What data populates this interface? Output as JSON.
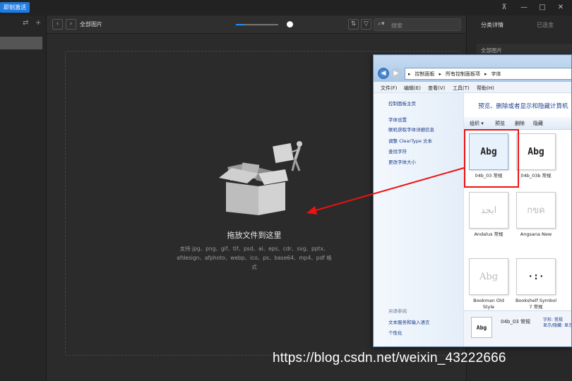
{
  "titlebar": {
    "activate_label": "即刻激活",
    "pin_icon": "pin-icon",
    "minimize": "—",
    "maximize": "□",
    "close": "✕"
  },
  "sidebar": {
    "sort_icon": "⇄",
    "add_icon": "+"
  },
  "toolbar": {
    "back": "‹",
    "forward": "›",
    "folder_title": "全部图片",
    "zoom_level": 0.18,
    "sort_icon": "⇅",
    "filter_icon": "▽",
    "search_icon": "⌕▾",
    "search_placeholder": "搜索"
  },
  "dropzone": {
    "title": "拖放文件到这里",
    "formats": "支持 jpg、png、gif、tif、psd、ai、eps、cdr、svg、pptx、afdesign、afphoto、webp、ico、ps、base64、mp4、pdf 格式"
  },
  "right_panel": {
    "tab_details": "分类详情",
    "tab_other": "已选金",
    "field": "全部图片"
  },
  "explorer": {
    "path": [
      "控制面板",
      "所有控制面板项",
      "字体"
    ],
    "menu": [
      "文件(F)",
      "编辑(E)",
      "查看(V)",
      "工具(T)",
      "帮助(H)"
    ],
    "left_links": [
      "控制面板主页",
      "字体设置",
      "联机获取字体详细信息",
      "调整 ClearType 文本",
      "查找字符",
      "更改字体大小"
    ],
    "see_also_title": "另请参阅",
    "see_also_links": [
      "文本服务和输入语言",
      "个性化"
    ],
    "heading": "预览、删除或者显示和隐藏计算机",
    "commands": [
      "组织 ▾",
      "预览",
      "删除",
      "隐藏"
    ],
    "fonts": [
      {
        "glyph": "Abg",
        "name": "04b_03 常规",
        "faded": false
      },
      {
        "glyph": "Abg",
        "name": "04b_03b 常规",
        "faded": false
      },
      {
        "glyph": "ابجد",
        "name": "Andalus 常规",
        "faded": true
      },
      {
        "glyph": "กขค",
        "name": "Angsana New",
        "faded": true
      },
      {
        "glyph": "Abg",
        "name": "Bookman Old Style",
        "faded": true
      },
      {
        "glyph": "·:·",
        "name": "Bookshelf Symbol 7 常规",
        "faded": false
      }
    ],
    "status_thumb": "Abg",
    "status_name": "04b_03 常规",
    "status_meta": [
      "字形: 常规",
      "显示/隐藏: 显示"
    ]
  },
  "watermark": "https://blog.csdn.net/weixin_43222666"
}
